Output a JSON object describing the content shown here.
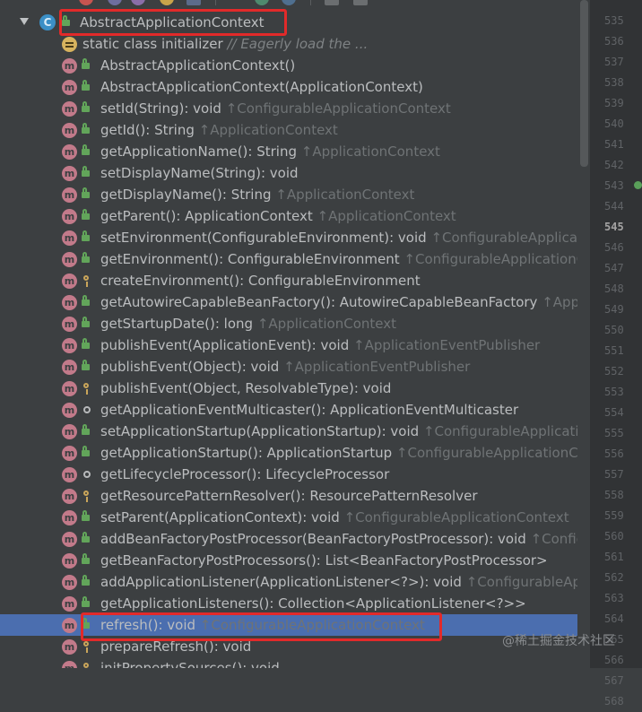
{
  "structure": {
    "root_label": "AbstractApplicationContext",
    "initializer_label": "static class initializer",
    "initializer_comment": "// Eagerly load the ..."
  },
  "members": [
    {
      "name": "AbstractApplicationContext()",
      "inherited": "",
      "visibility": "public"
    },
    {
      "name": "AbstractApplicationContext(ApplicationContext)",
      "inherited": "",
      "visibility": "public"
    },
    {
      "name": "setId(String): void",
      "inherited": "↑ConfigurableApplicationContext",
      "visibility": "public"
    },
    {
      "name": "getId(): String",
      "inherited": "↑ApplicationContext",
      "visibility": "public"
    },
    {
      "name": "getApplicationName(): String",
      "inherited": "↑ApplicationContext",
      "visibility": "public"
    },
    {
      "name": "setDisplayName(String): void",
      "inherited": "",
      "visibility": "public"
    },
    {
      "name": "getDisplayName(): String",
      "inherited": "↑ApplicationContext",
      "visibility": "public"
    },
    {
      "name": "getParent(): ApplicationContext",
      "inherited": "↑ApplicationContext",
      "visibility": "public"
    },
    {
      "name": "setEnvironment(ConfigurableEnvironment): void",
      "inherited": "↑ConfigurableApplicationC",
      "visibility": "public"
    },
    {
      "name": "getEnvironment(): ConfigurableEnvironment",
      "inherited": "↑ConfigurableApplicationCont",
      "visibility": "public"
    },
    {
      "name": "createEnvironment(): ConfigurableEnvironment",
      "inherited": "",
      "visibility": "protected"
    },
    {
      "name": "getAutowireCapableBeanFactory(): AutowireCapableBeanFactory",
      "inherited": "↑Applicat",
      "visibility": "public"
    },
    {
      "name": "getStartupDate(): long",
      "inherited": "↑ApplicationContext",
      "visibility": "public"
    },
    {
      "name": "publishEvent(ApplicationEvent): void",
      "inherited": "↑ApplicationEventPublisher",
      "visibility": "public"
    },
    {
      "name": "publishEvent(Object): void",
      "inherited": "↑ApplicationEventPublisher",
      "visibility": "public"
    },
    {
      "name": "publishEvent(Object, ResolvableType): void",
      "inherited": "",
      "visibility": "protected"
    },
    {
      "name": "getApplicationEventMulticaster(): ApplicationEventMulticaster",
      "inherited": "",
      "visibility": "package"
    },
    {
      "name": "setApplicationStartup(ApplicationStartup): void",
      "inherited": "↑ConfigurableApplicationC",
      "visibility": "public"
    },
    {
      "name": "getApplicationStartup(): ApplicationStartup",
      "inherited": "↑ConfigurableApplicationConte",
      "visibility": "public"
    },
    {
      "name": "getLifecycleProcessor(): LifecycleProcessor",
      "inherited": "",
      "visibility": "package"
    },
    {
      "name": "getResourcePatternResolver(): ResourcePatternResolver",
      "inherited": "",
      "visibility": "protected"
    },
    {
      "name": "setParent(ApplicationContext): void",
      "inherited": "↑ConfigurableApplicationContext",
      "visibility": "public"
    },
    {
      "name": "addBeanFactoryPostProcessor(BeanFactoryPostProcessor): void",
      "inherited": "↑Configura",
      "visibility": "public"
    },
    {
      "name": "getBeanFactoryPostProcessors(): List<BeanFactoryPostProcessor>",
      "inherited": "",
      "visibility": "public"
    },
    {
      "name": "addApplicationListener(ApplicationListener<?>): void",
      "inherited": "↑ConfigurableApplica",
      "visibility": "public"
    },
    {
      "name": "getApplicationListeners(): Collection<ApplicationListener<?>>",
      "inherited": "",
      "visibility": "public"
    },
    {
      "name": "refresh(): void",
      "inherited": "↑ConfigurableApplicationContext",
      "visibility": "public"
    },
    {
      "name": "prepareRefresh(): void",
      "inherited": "",
      "visibility": "protected"
    },
    {
      "name": "initPropertySources(): void",
      "inherited": "",
      "visibility": "protected"
    }
  ],
  "selected_member": "refresh(): void",
  "gutter": {
    "line_numbers": [
      "535",
      "536",
      "537",
      "538",
      "539",
      "540",
      "541",
      "542",
      "543",
      "544",
      "545",
      "546",
      "547",
      "548",
      "549",
      "550",
      "551",
      "552",
      "553",
      "554",
      "555",
      "556",
      "557",
      "558",
      "559",
      "560",
      "561",
      "562",
      "563",
      "564",
      "565",
      "566",
      "567",
      "568"
    ],
    "current_line": "545"
  },
  "watermark": "@稀土掘金技术社区",
  "colors": {
    "background": "#3c3f41",
    "selection": "#4b6eaf",
    "method_icon": "#c27a8a",
    "class_icon": "#3b8fc6",
    "public_lock": "#62a55a",
    "highlight_box": "#e22a2a"
  },
  "icons": {
    "expand": "chevron-down-icon",
    "class": "class-icon",
    "method": "method-icon",
    "initializer": "initializer-icon"
  }
}
